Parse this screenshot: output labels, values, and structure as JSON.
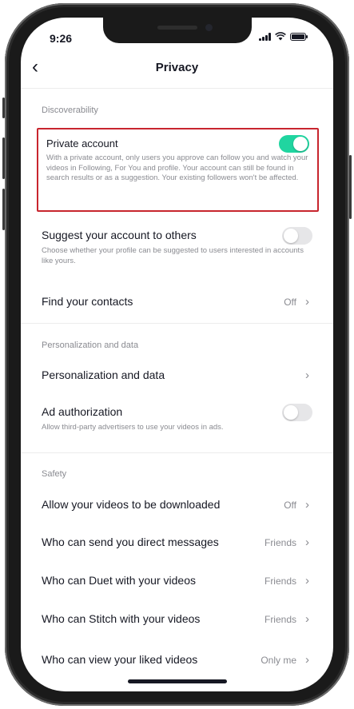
{
  "status_bar": {
    "time": "9:26"
  },
  "nav": {
    "back_icon": "chevron-left-icon",
    "title": "Privacy"
  },
  "sections": {
    "discoverability": "Discoverability",
    "personalization": "Personalization and data",
    "safety": "Safety"
  },
  "private_account": {
    "title": "Private account",
    "description": "With a private account, only users you approve can follow you and watch your videos in Following, For You and profile. Your account can still be found in search results or as a suggestion. Your existing followers won't be affected.",
    "enabled": true
  },
  "suggest_account": {
    "title": "Suggest your account to others",
    "description": "Choose whether your profile can be suggested to users interested in accounts like yours.",
    "enabled": false
  },
  "find_contacts": {
    "title": "Find your contacts",
    "value": "Off"
  },
  "personalization_row": {
    "title": "Personalization and data"
  },
  "ad_authorization": {
    "title": "Ad authorization",
    "description": "Allow third-party advertisers to use your videos in ads.",
    "enabled": false
  },
  "safety_rows": [
    {
      "title": "Allow your videos to be downloaded",
      "value": "Off"
    },
    {
      "title": "Who can send you direct messages",
      "value": "Friends"
    },
    {
      "title": "Who can Duet with your videos",
      "value": "Friends"
    },
    {
      "title": "Who can Stitch with your videos",
      "value": "Friends"
    },
    {
      "title": "Who can view your liked videos",
      "value": "Only me"
    }
  ],
  "colors": {
    "toggle_on": "#20d5a0",
    "highlight_border": "#c8252e"
  }
}
